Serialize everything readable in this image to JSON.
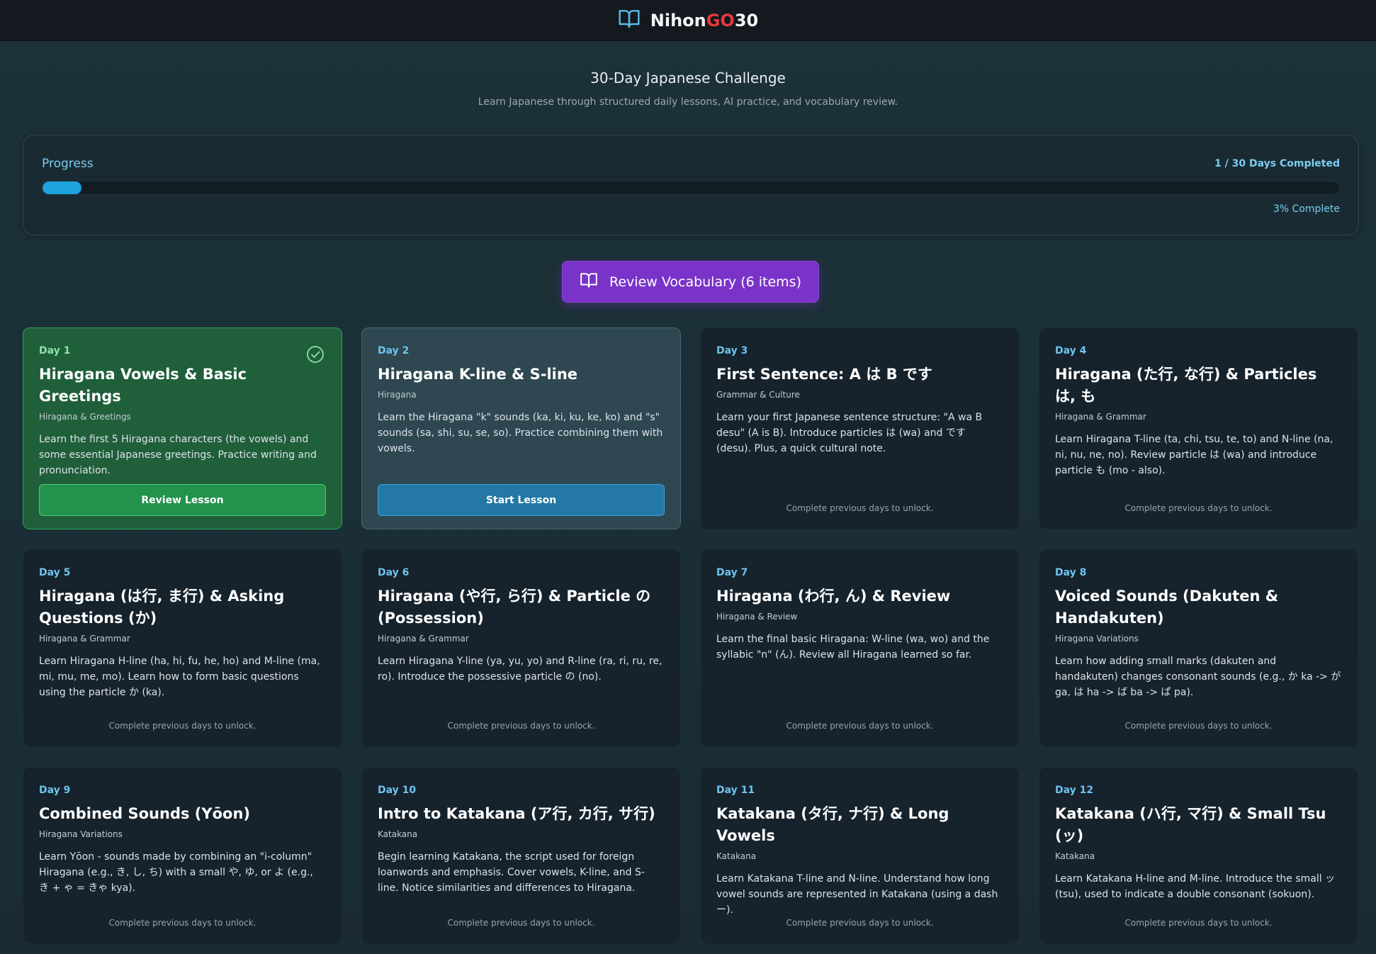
{
  "header": {
    "brand_prefix": "Nihon",
    "brand_accent": "GO",
    "brand_suffix": "30",
    "icon": "book-icon"
  },
  "hero": {
    "title": "30-Day Japanese Challenge",
    "subtitle": "Learn Japanese through structured daily lessons, AI practice, and vocabulary review."
  },
  "progress": {
    "label": "Progress",
    "count_text": "1 / 30 Days Completed",
    "percent_text": "3% Complete",
    "fraction": 0.03
  },
  "review_button": {
    "label": "Review Vocabulary (6 items)",
    "icon": "book-icon"
  },
  "lessons": [
    {
      "day": "Day 1",
      "title": "Hiragana Vowels & Basic Greetings",
      "category": "Hiragana & Greetings",
      "description": "Learn the first 5 Hiragana characters (the vowels) and some essential Japanese greetings. Practice writing and pronunciation.",
      "status": "completed",
      "action": "Review Lesson"
    },
    {
      "day": "Day 2",
      "title": "Hiragana K-line & S-line",
      "category": "Hiragana",
      "description": "Learn the Hiragana \"k\" sounds (ka, ki, ku, ke, ko) and \"s\" sounds (sa, shi, su, se, so). Practice combining them with vowels.",
      "status": "current",
      "action": "Start Lesson"
    },
    {
      "day": "Day 3",
      "title": "First Sentence: A は B です",
      "category": "Grammar & Culture",
      "description": "Learn your first Japanese sentence structure: \"A wa B desu\" (A is B). Introduce particles は (wa) and です (desu). Plus, a quick cultural note.",
      "status": "locked",
      "action": "Complete previous days to unlock."
    },
    {
      "day": "Day 4",
      "title": "Hiragana (た行, な行) & Particles は, も",
      "category": "Hiragana & Grammar",
      "description": "Learn Hiragana T-line (ta, chi, tsu, te, to) and N-line (na, ni, nu, ne, no). Review particle は (wa) and introduce particle も (mo - also).",
      "status": "locked",
      "action": "Complete previous days to unlock."
    },
    {
      "day": "Day 5",
      "title": "Hiragana (は行, ま行) & Asking Questions (か)",
      "category": "Hiragana & Grammar",
      "description": "Learn Hiragana H-line (ha, hi, fu, he, ho) and M-line (ma, mi, mu, me, mo). Learn how to form basic questions using the particle か (ka).",
      "status": "locked",
      "action": "Complete previous days to unlock."
    },
    {
      "day": "Day 6",
      "title": "Hiragana (や行, ら行) & Particle の (Possession)",
      "category": "Hiragana & Grammar",
      "description": "Learn Hiragana Y-line (ya, yu, yo) and R-line (ra, ri, ru, re, ro). Introduce the possessive particle の (no).",
      "status": "locked",
      "action": "Complete previous days to unlock."
    },
    {
      "day": "Day 7",
      "title": "Hiragana (わ行, ん) & Review",
      "category": "Hiragana & Review",
      "description": "Learn the final basic Hiragana: W-line (wa, wo) and the syllabic \"n\" (ん). Review all Hiragana learned so far.",
      "status": "locked",
      "action": "Complete previous days to unlock."
    },
    {
      "day": "Day 8",
      "title": "Voiced Sounds (Dakuten & Handakuten)",
      "category": "Hiragana Variations",
      "description": "Learn how adding small marks (dakuten and handakuten) changes consonant sounds (e.g., か ka -> が ga, は ha -> ば ba -> ぱ pa).",
      "status": "locked",
      "action": "Complete previous days to unlock."
    },
    {
      "day": "Day 9",
      "title": "Combined Sounds (Yōon)",
      "category": "Hiragana Variations",
      "description": "Learn Yōon - sounds made by combining an \"i-column\" Hiragana (e.g., き, し, ち) with a small や, ゆ, or よ (e.g., き + ゃ = きゃ kya).",
      "status": "locked",
      "action": "Complete previous days to unlock."
    },
    {
      "day": "Day 10",
      "title": "Intro to Katakana (ア行, カ行, サ行)",
      "category": "Katakana",
      "description": "Begin learning Katakana, the script used for foreign loanwords and emphasis. Cover vowels, K-line, and S-line. Notice similarities and differences to Hiragana.",
      "status": "locked",
      "action": "Complete previous days to unlock."
    },
    {
      "day": "Day 11",
      "title": "Katakana (タ行, ナ行) & Long Vowels",
      "category": "Katakana",
      "description": "Learn Katakana T-line and N-line. Understand how long vowel sounds are represented in Katakana (using a dash ー).",
      "status": "locked",
      "action": "Complete previous days to unlock."
    },
    {
      "day": "Day 12",
      "title": "Katakana (ハ行, マ行) & Small Tsu (ッ)",
      "category": "Katakana",
      "description": "Learn Katakana H-line and M-line. Introduce the small ッ (tsu), used to indicate a double consonant (sokuon).",
      "status": "locked",
      "action": "Complete previous days to unlock."
    }
  ],
  "colors": {
    "accent_blue": "#1ea3dd",
    "completed_green": "#24914d",
    "review_purple": "#7a33c9",
    "brand_red": "#e5383b"
  }
}
